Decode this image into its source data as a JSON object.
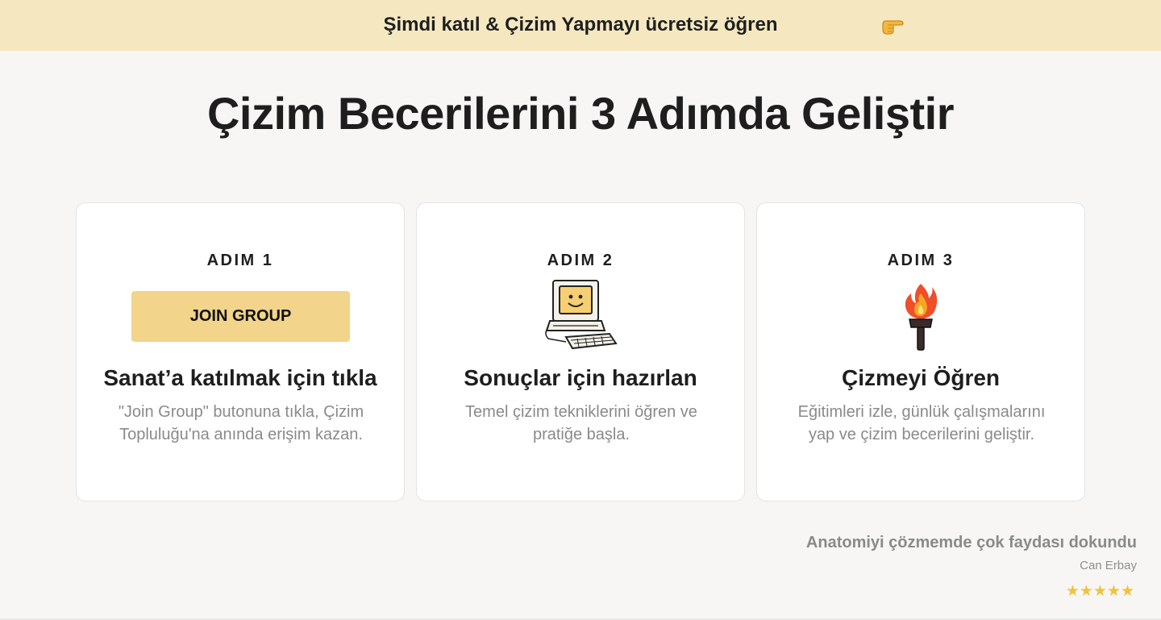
{
  "banner": {
    "text": "Şimdi katıl & Çizim Yapmayı ücretsiz öğren",
    "icon": "pointing-hand-icon",
    "bg_color": "#f5e8c1"
  },
  "headline": "Çizim Becerilerini 3 Adımda Geliştir",
  "steps": [
    {
      "label": "ADIM 1",
      "button_label": "JOIN GROUP",
      "title": "Sanat’a katılmak için tıkla",
      "description": "\"Join Group\" butonuna tıkla, Çizim Topluluğu'na anında erişim kazan."
    },
    {
      "label": "ADIM 2",
      "icon": "retro-computer-icon",
      "title": "Sonuçlar için hazırlan",
      "description": "Temel çizim tekniklerini öğren ve pratiğe başla."
    },
    {
      "label": "ADIM 3",
      "icon": "torch-icon",
      "title": "Çizmeyi Öğren",
      "description": "Eğitimleri izle, günlük çalışmalarını yap ve çizim becerilerini geliştir."
    }
  ],
  "testimonial": {
    "quote": "Anatomiyi çözmemde çok faydası dokundu",
    "author": "Can Erbay",
    "stars": "★★★★★",
    "rating": 5
  },
  "colors": {
    "accent": "#f2d48a",
    "star": "#f0c23d",
    "background": "#f7f6f4"
  }
}
